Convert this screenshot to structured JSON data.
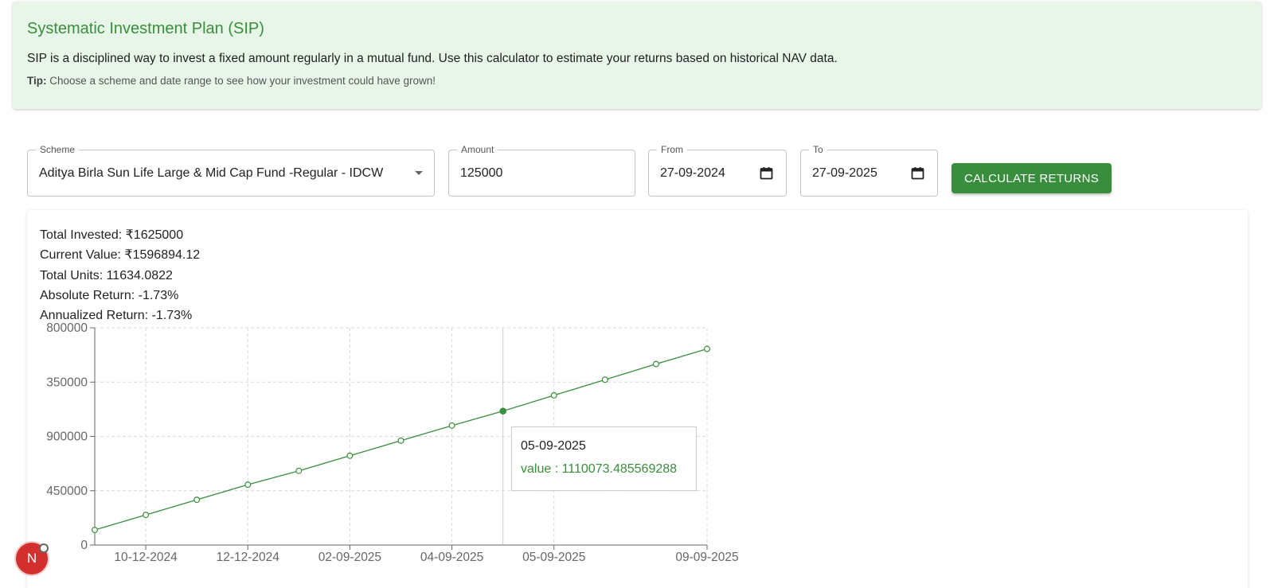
{
  "info": {
    "title": "Systematic Investment Plan (SIP)",
    "description": "SIP is a disciplined way to invest a fixed amount regularly in a mutual fund. Use this calculator to estimate your returns based on historical NAV data.",
    "tip_label": "Tip:",
    "tip_text": "Choose a scheme and date range to see how your investment could have grown!"
  },
  "form": {
    "scheme_label": "Scheme",
    "scheme_value": "Aditya Birla Sun Life Large & Mid Cap Fund -Regular - IDCW",
    "amount_label": "Amount",
    "amount_value": "125000",
    "from_label": "From",
    "from_value": "27-09-2024",
    "to_label": "To",
    "to_value": "27-09-2025",
    "calculate_label": "Calculate Returns"
  },
  "results": {
    "total_invested": "Total Invested: ₹1625000",
    "current_value": "Current Value: ₹1596894.12",
    "total_units": "Total Units: 11634.0822",
    "absolute_return": "Absolute Return: -1.73%",
    "annualized_return": "Annualized Return: -1.73%"
  },
  "tooltip": {
    "date": "05-09-2025",
    "value_text": "value : 1110073.485569288"
  },
  "badge": {
    "letter": "N"
  },
  "colors": {
    "accent": "#388e3c",
    "info_bg": "#e8f5e9",
    "badge": "#d32f2f"
  },
  "chart_data": {
    "type": "line",
    "xlabel": "",
    "ylabel": "",
    "y_tick_labels": [
      "0",
      "450000",
      "900000",
      "350000",
      "800000"
    ],
    "x_tick_labels": [
      "10-12-2024",
      "12-12-2024",
      "02-09-2025",
      "04-09-2025",
      "05-09-2025",
      "09-09-2025"
    ],
    "x_tick_indices": [
      1,
      3,
      5,
      7,
      9,
      12
    ],
    "ylim": [
      0,
      1800000
    ],
    "series": [
      {
        "values": [
          125000,
          250000,
          375000,
          500000,
          615000,
          740000,
          865000,
          990000,
          1110073.485569288,
          1240000,
          1370000,
          1500000,
          1625000
        ]
      }
    ],
    "highlight_index": 8,
    "grid": true
  }
}
